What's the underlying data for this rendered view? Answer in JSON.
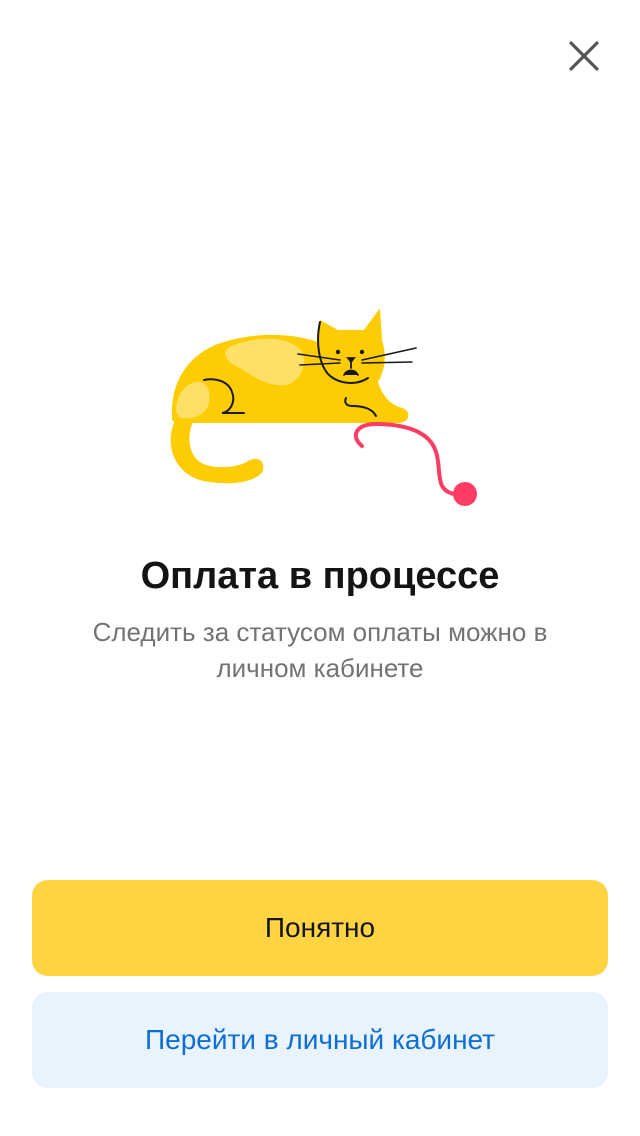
{
  "dialog": {
    "close_icon": "close-icon",
    "illustration": "sad-cat-with-yarn",
    "title": "Оплата в процессе",
    "subtitle": "Следить за статусом оплаты можно в личном кабинете"
  },
  "actions": {
    "primary_label": "Понятно",
    "secondary_label": "Перейти в личный кабинет"
  },
  "colors": {
    "primary_button": "#fed442",
    "secondary_button": "#e8f3fd",
    "link_text": "#0f6ed2",
    "cat": "#fecc02",
    "yarn": "#ff3c64"
  }
}
